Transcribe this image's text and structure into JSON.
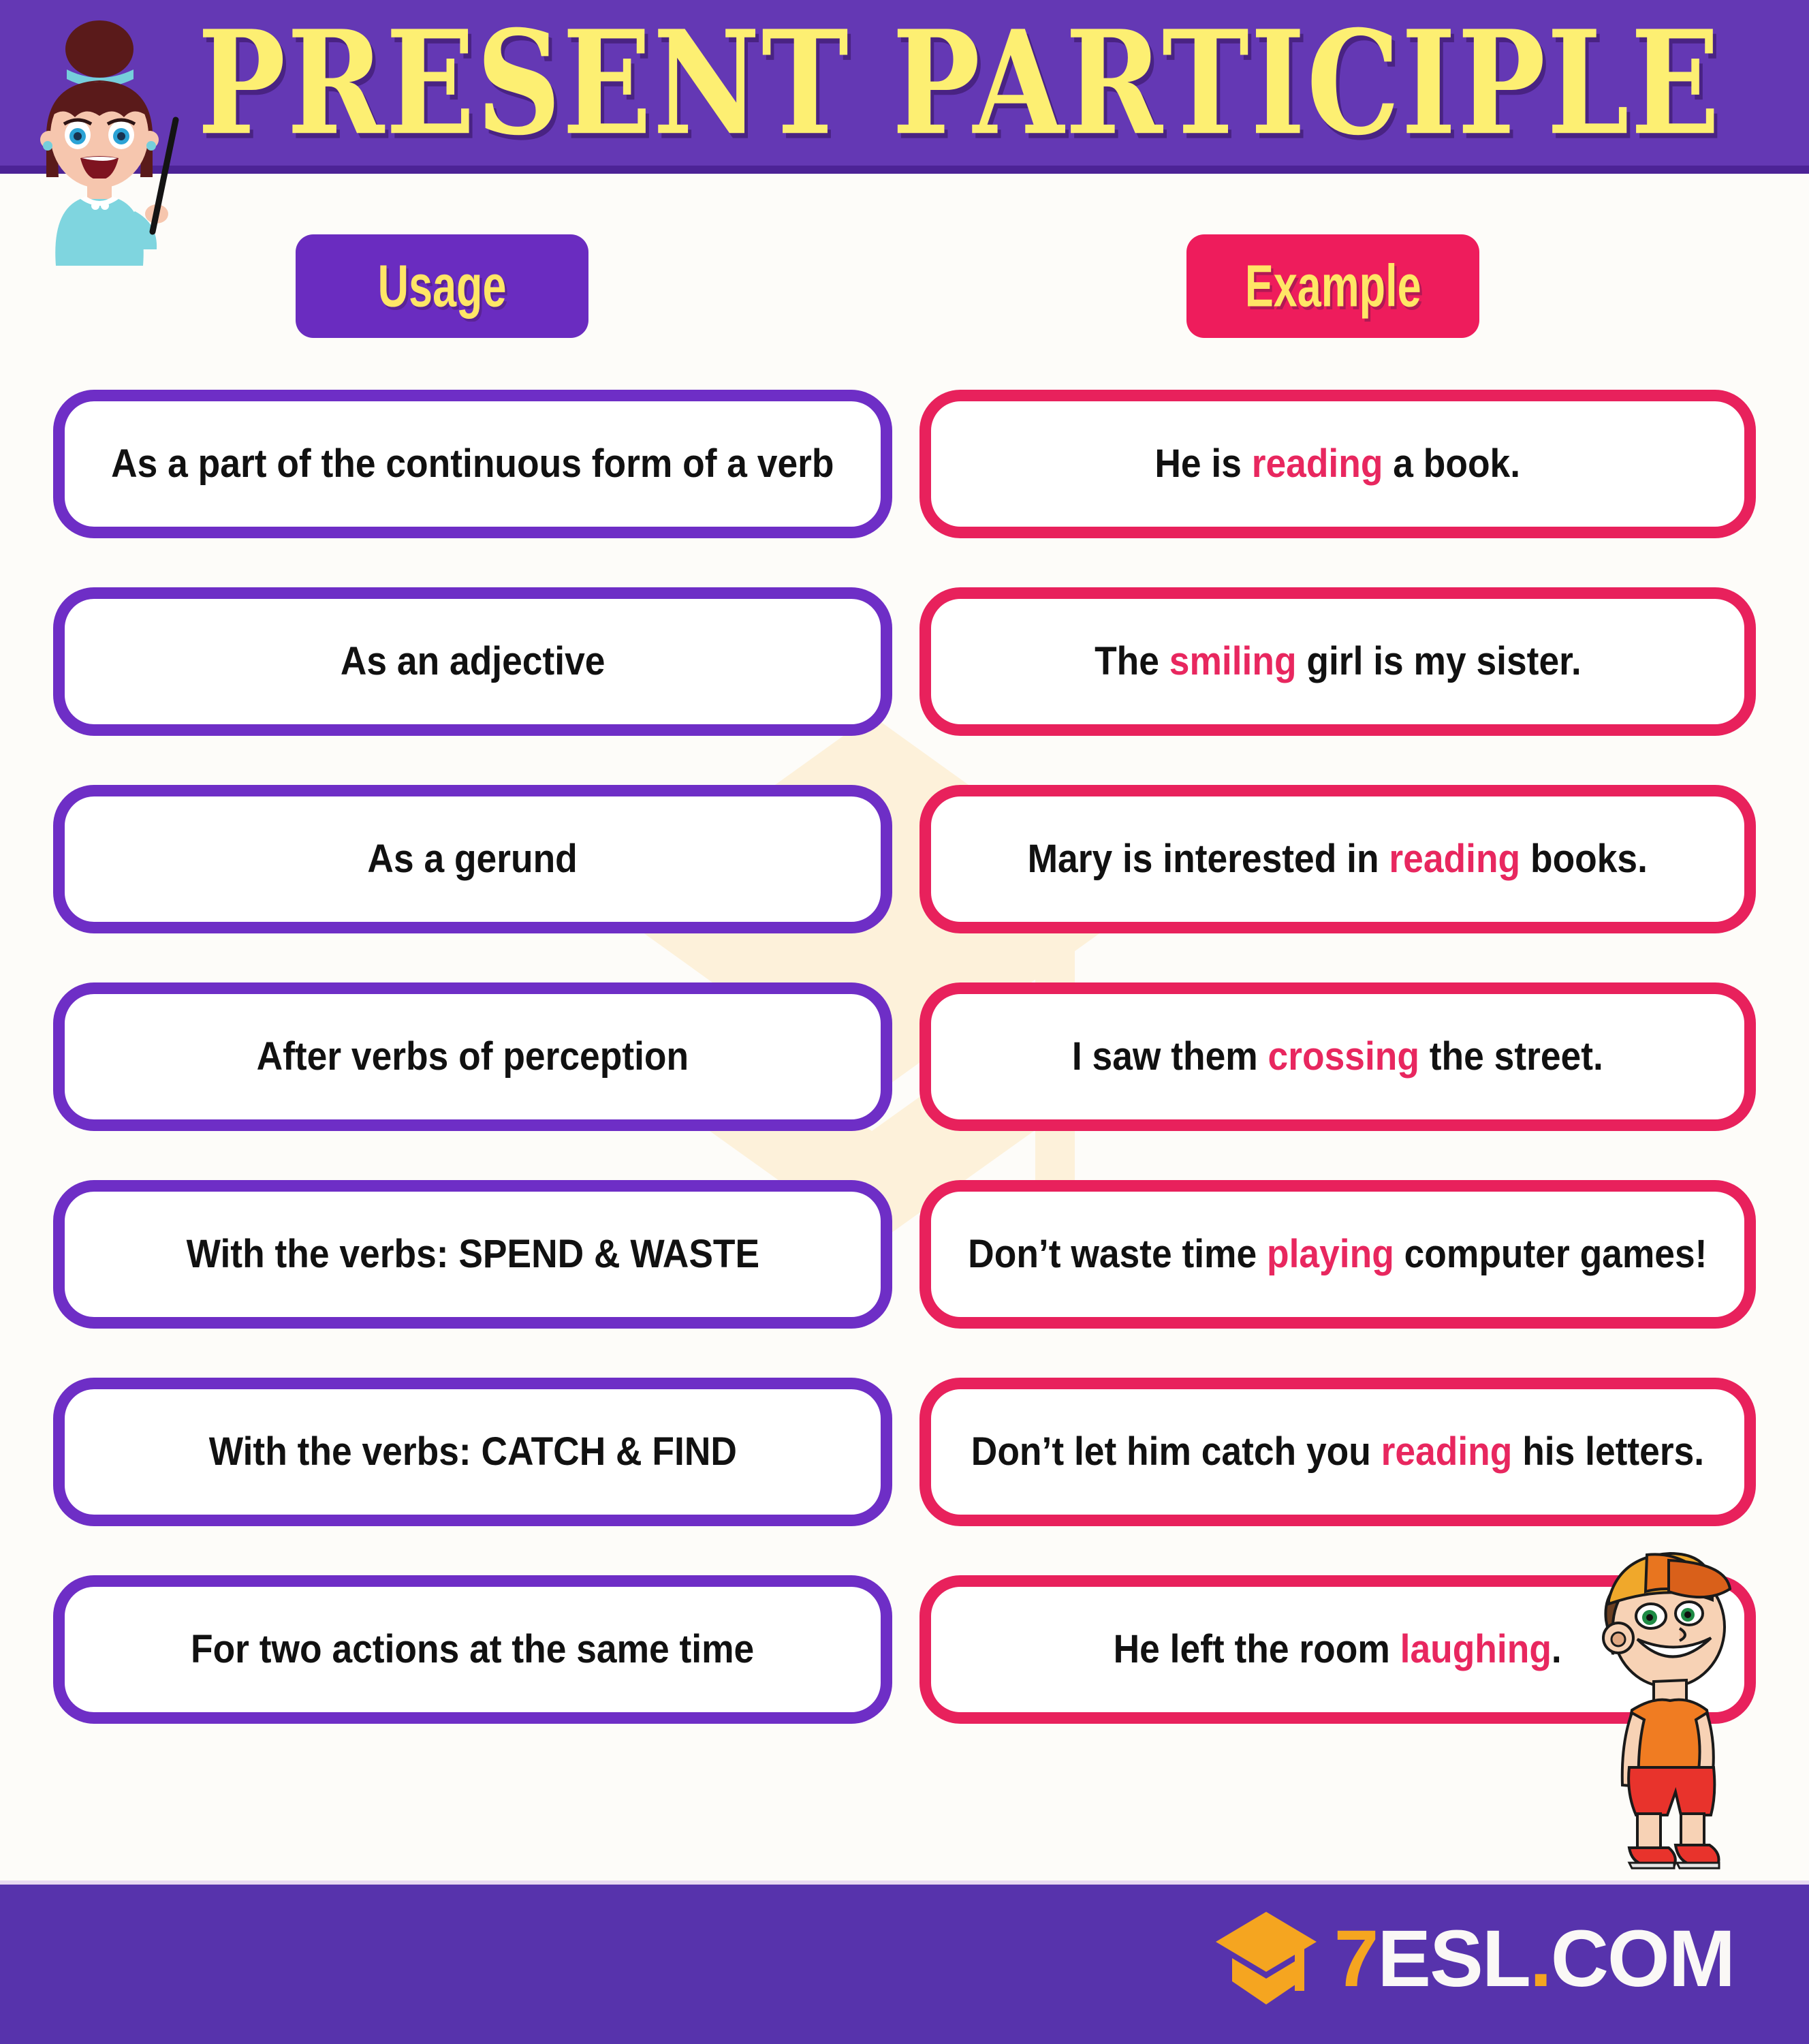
{
  "page": {
    "title": "PRESENT PARTICIPLE",
    "background_color": "#FDFCF9"
  },
  "header": {
    "title": "PRESENT PARTICIPLE",
    "bar_color": "#6438B4",
    "title_color": "#FDEF72",
    "character": "teacher-girl-with-pointer"
  },
  "columns": {
    "usage_label": "Usage",
    "example_label": "Example",
    "usage_badge_color": "#6A2CC0",
    "example_badge_color": "#EE1C5C",
    "badge_text_color": "#FFE666"
  },
  "rows": [
    {
      "usage": "As a part of the continuous form of a verb",
      "example_before": "He is ",
      "example_highlight": "reading",
      "example_after": " a book."
    },
    {
      "usage": "As an adjective",
      "example_before": "The ",
      "example_highlight": "smiling",
      "example_after": " girl is my sister."
    },
    {
      "usage": "As a gerund",
      "example_before": "Mary is interested in ",
      "example_highlight": "reading",
      "example_after": " books."
    },
    {
      "usage": "After verbs of perception",
      "example_before": "I saw them ",
      "example_highlight": "crossing",
      "example_after": " the street."
    },
    {
      "usage": "With the verbs: SPEND & WASTE",
      "example_before": "Don’t waste time ",
      "example_highlight": "playing",
      "example_after": " computer games!"
    },
    {
      "usage": "With the verbs: CATCH & FIND",
      "example_before": "Don’t let him catch you ",
      "example_highlight": "reading",
      "example_after": " his letters."
    },
    {
      "usage": "For two actions at the same time",
      "example_before": "He left the room ",
      "example_highlight": "laughing",
      "example_after": "."
    }
  ],
  "style": {
    "usage_border_color": "#6E2EC6",
    "example_border_color": "#E8215C",
    "highlight_color": "#E8275F",
    "watermark_color": "#FDF1DA"
  },
  "footer": {
    "bar_color": "#5733AC",
    "logo_seven": "7",
    "logo_esl": "ESL",
    "logo_dot": ".",
    "logo_com": "COM",
    "logo_mark": "graduation-cap-icon",
    "character": "boy-with-orange-cap"
  }
}
